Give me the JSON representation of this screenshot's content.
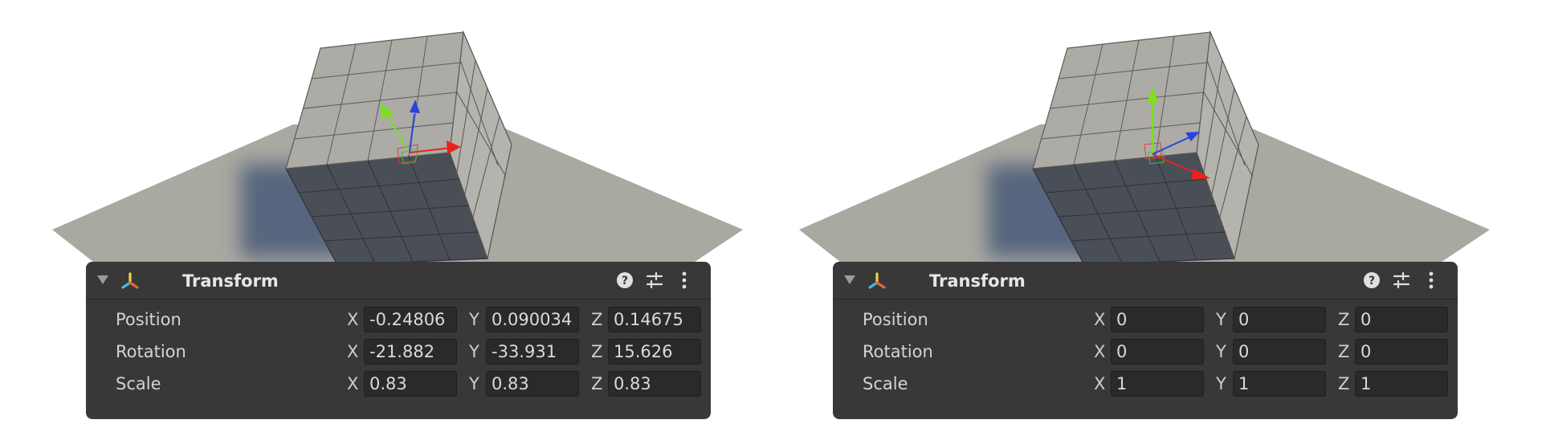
{
  "panels": [
    {
      "component": {
        "title": "Transform",
        "icons": [
          "foldout-arrow-icon",
          "transform-icon",
          "help-icon",
          "preset-icon",
          "kebab-menu-icon"
        ]
      },
      "rows": [
        {
          "label": "Position",
          "x_axis": "X",
          "x": "-0.24806",
          "y_axis": "Y",
          "y": "0.090034",
          "z_axis": "Z",
          "z": "0.14675"
        },
        {
          "label": "Rotation",
          "x_axis": "X",
          "x": "-21.882",
          "y_axis": "Y",
          "y": "-33.931",
          "z_axis": "Z",
          "z": "15.626"
        },
        {
          "label": "Scale",
          "x_axis": "X",
          "x": "0.83",
          "y_axis": "Y",
          "y": "0.83",
          "z_axis": "Z",
          "z": "0.83"
        }
      ]
    },
    {
      "component": {
        "title": "Transform",
        "icons": [
          "foldout-arrow-icon",
          "transform-icon",
          "help-icon",
          "preset-icon",
          "kebab-menu-icon"
        ]
      },
      "rows": [
        {
          "label": "Position",
          "x_axis": "X",
          "x": "0",
          "y_axis": "Y",
          "y": "0",
          "z_axis": "Z",
          "z": "0"
        },
        {
          "label": "Rotation",
          "x_axis": "X",
          "x": "0",
          "y_axis": "Y",
          "y": "0",
          "z_axis": "Z",
          "z": "0"
        },
        {
          "label": "Scale",
          "x_axis": "X",
          "x": "1",
          "y_axis": "Y",
          "y": "1",
          "z_axis": "Z",
          "z": "1"
        }
      ]
    }
  ],
  "colors": {
    "inspector_bg": "#383838",
    "field_bg": "#2a2a2a",
    "ground": "#a9a8a1",
    "cube_top": "#acaba6",
    "cube_bottom": "#4a4e57",
    "shadow": "#4a5a78",
    "gizmo_x": "#e8231e",
    "gizmo_y": "#7be020",
    "gizmo_z": "#2944d9"
  }
}
